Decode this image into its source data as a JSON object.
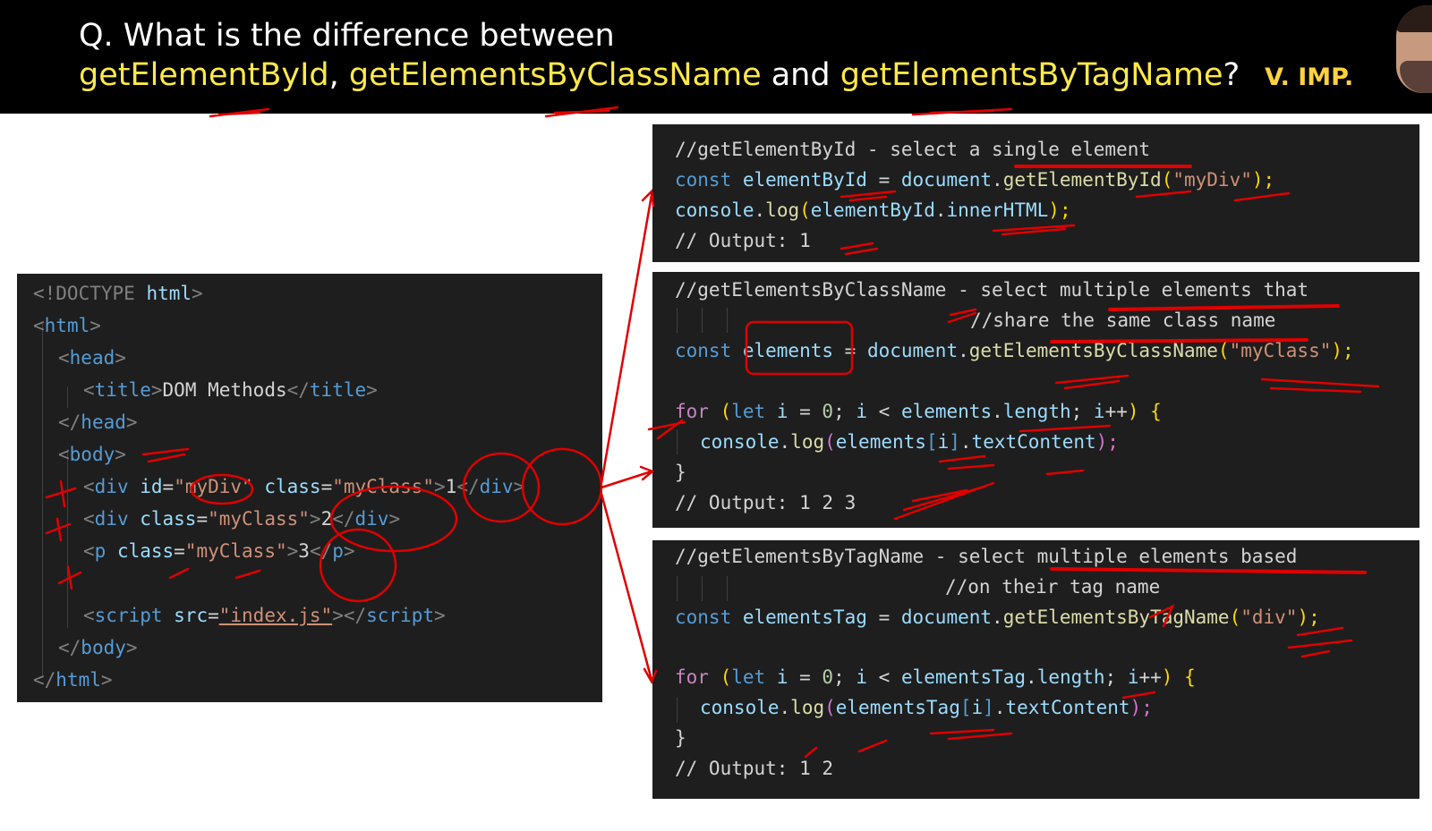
{
  "question": {
    "line1": "Q. What is the difference between",
    "m1": "getElementById",
    "sep1": ", ",
    "m2": "getElementsByClassName",
    "sep2": " and ",
    "m3": "getElementsByTagName",
    "end": "?",
    "badge": "V. IMP."
  },
  "html_code": {
    "l1": [
      "<!DOCTYPE",
      " html",
      ">"
    ],
    "l2": [
      "<",
      "html",
      ">"
    ],
    "l3": [
      "<",
      "head",
      ">"
    ],
    "l4": [
      "<",
      "title",
      ">",
      "DOM Methods",
      "</",
      "title",
      ">"
    ],
    "l5": [
      "</",
      "head",
      ">"
    ],
    "l6": [
      "<",
      "body",
      ">"
    ],
    "l7": [
      "<",
      "div",
      " id",
      "=",
      "\"myDiv\"",
      " class",
      "=",
      "\"myClass\"",
      ">",
      "1",
      "</",
      "div",
      ">"
    ],
    "l8": [
      "<",
      "div",
      " class",
      "=",
      "\"myClass\"",
      ">",
      "2",
      "</",
      "div",
      ">"
    ],
    "l9": [
      "<",
      "p",
      " class",
      "=",
      "\"myClass\"",
      ">",
      "3",
      "</",
      "p",
      ">"
    ],
    "l10": [
      "<",
      "script",
      " src",
      "=",
      "\"index.js\"",
      "></",
      "script",
      ">"
    ],
    "l11": [
      "</",
      "body",
      ">"
    ],
    "l12": [
      "</",
      "html",
      ">"
    ]
  },
  "panel1": {
    "comment": "//getElementById - select a single element",
    "l2": [
      "const",
      " elementById",
      " = ",
      "document",
      ".",
      "getElementById",
      "(",
      "\"myDiv\"",
      ");"
    ],
    "l3": [
      "console",
      ".",
      "log",
      "(",
      "elementById",
      ".",
      "innerHTML",
      ");"
    ],
    "output": "// Output: 1"
  },
  "panel2": {
    "comment1": "//getElementsByClassName - select multiple elements that",
    "comment2": "//share the same class name",
    "l3": [
      "const",
      " elements",
      " = ",
      "document",
      ".",
      "getElementsByClassName",
      "(",
      "\"myClass\"",
      ");"
    ],
    "l4": [
      "for",
      " (",
      "let",
      " i",
      " = ",
      "0",
      "; ",
      "i",
      " < ",
      "elements",
      ".",
      "length",
      "; ",
      "i",
      "++",
      ") ",
      "{"
    ],
    "l5": [
      "console",
      ".",
      "log",
      "(",
      "elements",
      "[",
      "i",
      "]",
      ".",
      "textContent",
      ");"
    ],
    "l6": "}",
    "output": "// Output: 1 2 3"
  },
  "panel3": {
    "comment1": "//getElementsByTagName - select multiple elements based",
    "comment2": "//on their tag name",
    "l3": [
      "const",
      " elementsTag",
      " = ",
      "document",
      ".",
      "getElementsByTagName",
      "(",
      "\"div\"",
      ");"
    ],
    "l4": [
      "for",
      " (",
      "let",
      " i",
      " = ",
      "0",
      "; ",
      "i",
      " < ",
      "elementsTag",
      ".",
      "length",
      "; ",
      "i",
      "++",
      ") ",
      "{"
    ],
    "l5": [
      "console",
      ".",
      "log",
      "(",
      "elementsTag",
      "[",
      "i",
      "]",
      ".",
      "textContent",
      ");"
    ],
    "l6": "}",
    "output": "// Output: 1 2"
  },
  "colors": {
    "header_bg": "#000000",
    "highlight": "#ffe94a",
    "badge": "#ffd23f",
    "code_bg": "#1e1e1e",
    "annotation": "#e00000"
  }
}
